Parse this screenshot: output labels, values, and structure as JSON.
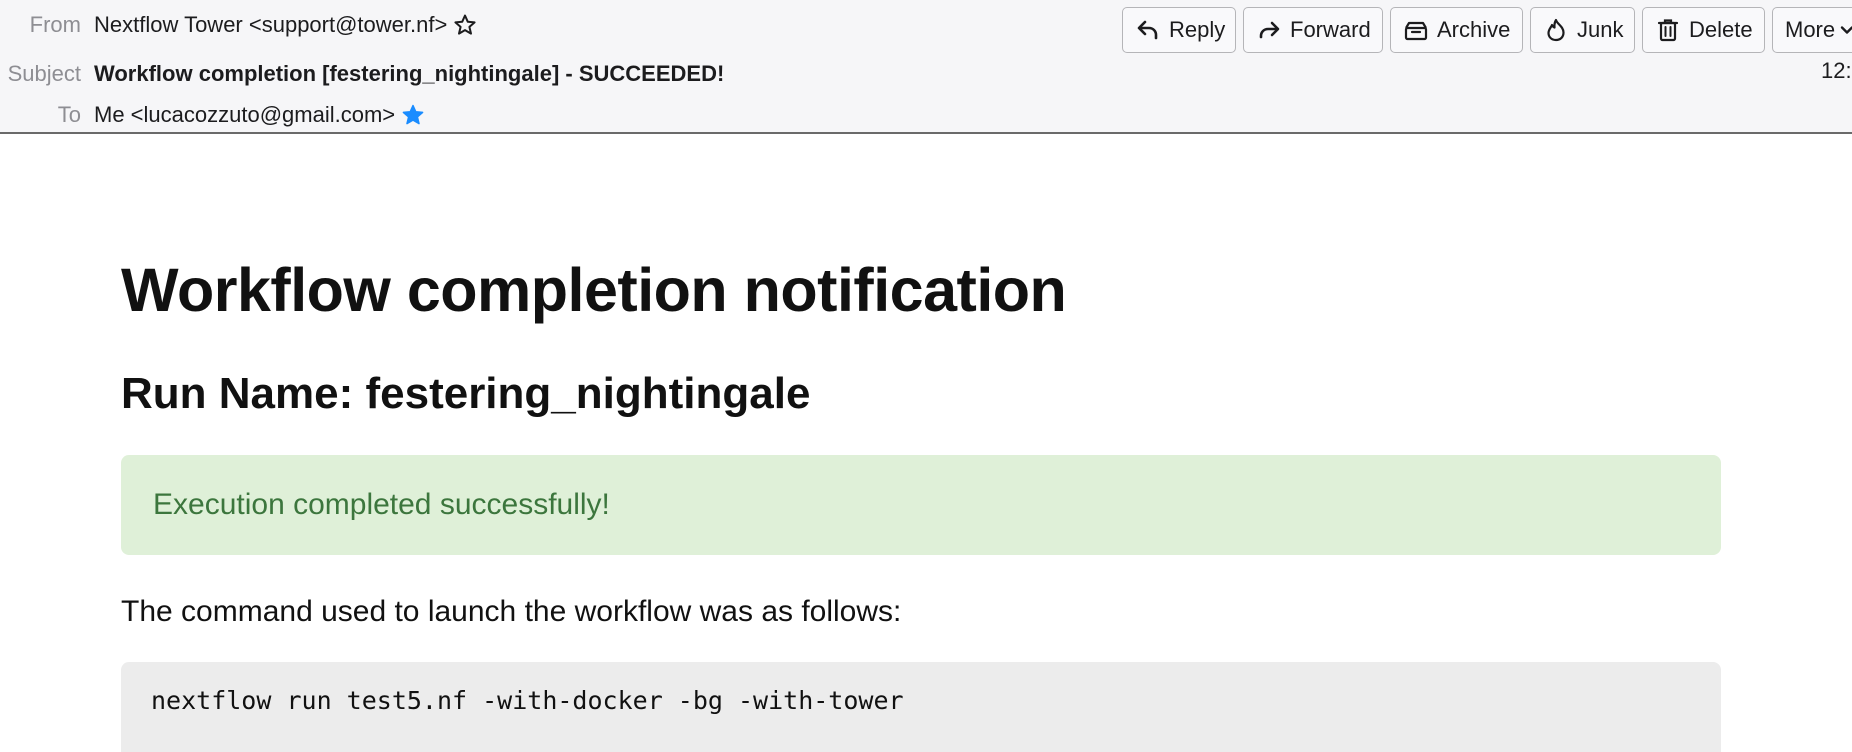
{
  "header": {
    "from": {
      "label": "From",
      "value": "Nextflow Tower <support@tower.nf>"
    },
    "subject": {
      "label": "Subject",
      "value": "Workflow completion [festering_nightingale] - SUCCEEDED!"
    },
    "to": {
      "label": "To",
      "value": "Me <lucacozzuto@gmail.com>"
    },
    "time": "12:",
    "toolbar": {
      "reply": "Reply",
      "forward": "Forward",
      "archive": "Archive",
      "junk": "Junk",
      "delete": "Delete",
      "more": "More"
    },
    "icons": {
      "from_star": "star-outline-icon",
      "to_star": "star-filled-icon",
      "reply": "reply-icon",
      "forward": "forward-icon",
      "archive": "archive-icon",
      "junk": "flame-icon",
      "delete": "trash-icon",
      "more": "chevron-down-icon"
    },
    "colors": {
      "to_star": "#1a8cff"
    }
  },
  "email": {
    "title": "Workflow completion notification",
    "run_name": "Run Name: festering_nightingale",
    "status_message": "Execution completed successfully!",
    "command_intro": "The command used to launch the workflow was as follows:",
    "command": "nextflow run test5.nf -with-docker -bg -with-tower",
    "colors": {
      "success_bg": "#dff0d8",
      "success_text": "#3c763d",
      "code_bg": "#ececec"
    }
  }
}
